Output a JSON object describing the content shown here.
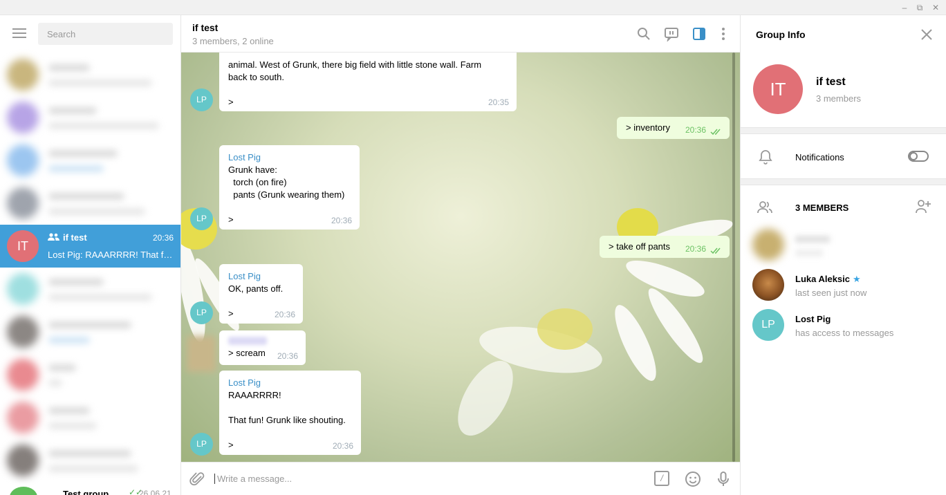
{
  "window": {
    "minimize_glyph": "–",
    "maximize_glyph": "⧉",
    "close_glyph": "✕"
  },
  "sidebar": {
    "search_placeholder": "Search",
    "active_chat": {
      "initials": "IT",
      "name": "if test",
      "time": "20:36",
      "preview": "Lost Pig: RAAARRRR!  That fun! Grunk like shouting."
    },
    "bottom_chat": {
      "name": "Test group",
      "time": "26.06.21"
    },
    "blurred_avatar_colors": [
      "#c9b67e",
      "#b7a4e6",
      "#9cc6f0",
      "#9fa4ad",
      "#9fdfe0",
      "#8c8784",
      "#e98a90",
      "#ea9ca2",
      "#857f7c"
    ]
  },
  "header": {
    "title": "if test",
    "subtitle": "3 members, 2 online"
  },
  "messages": [
    {
      "id": "m1",
      "dir": "in",
      "sender": "",
      "text": "animal. West of Grunk, there big field with little stone wall. Farm\nback to south.\n\n>",
      "time": "20:35",
      "avatar": "LP"
    },
    {
      "id": "m2",
      "dir": "out",
      "text": "> inventory",
      "time": "20:36"
    },
    {
      "id": "m3",
      "dir": "in",
      "sender": "Lost Pig",
      "text": "Grunk have:\n  torch (on fire)\n  pants (Grunk wearing them)\n\n>",
      "time": "20:36",
      "avatar": "LP"
    },
    {
      "id": "m4",
      "dir": "out",
      "text": "> take off pants",
      "time": "20:36"
    },
    {
      "id": "m5",
      "dir": "in",
      "sender": "Lost Pig",
      "text": "OK, pants off.\n\n>",
      "time": "20:36",
      "avatar": "LP"
    },
    {
      "id": "m6",
      "dir": "in",
      "sender": "",
      "text": "> scream",
      "time": "20:36"
    },
    {
      "id": "m7",
      "dir": "in",
      "sender": "Lost Pig",
      "text": "RAAARRRR!\n\nThat fun! Grunk like shouting.\n\n>",
      "time": "20:36",
      "avatar": "LP"
    }
  ],
  "composer": {
    "placeholder": "Write a message...",
    "command_glyph": "/"
  },
  "info": {
    "title": "Group Info",
    "initials": "IT",
    "name": "if test",
    "member_count": "3 members",
    "notifications_label": "Notifications",
    "notifications_on": false,
    "members_title": "3 MEMBERS",
    "members": [
      {
        "name": "Luka Aleksic",
        "status": "last seen just now",
        "admin_star": "★"
      },
      {
        "name": "Lost Pig",
        "status": "has access to messages",
        "initials": "LP"
      }
    ]
  },
  "colors": {
    "accent": "#419fd9",
    "red_avatar": "#e17076",
    "teal_avatar": "#65c7c9",
    "outgoing_bubble": "#effdde",
    "sender_name": "#3a8fc7"
  }
}
